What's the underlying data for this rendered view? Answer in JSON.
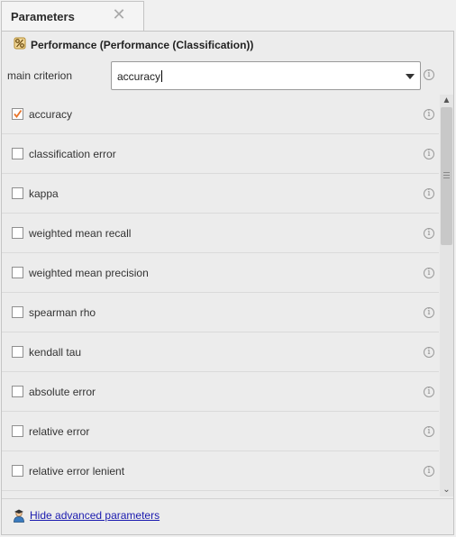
{
  "tab": {
    "label": "Parameters",
    "close_glyph": "✕",
    "close_icon": "close-icon"
  },
  "operator": {
    "icon": "performance-percent-icon",
    "title": "Performance (Performance (Classification))"
  },
  "main_criterion": {
    "label": "main criterion",
    "value": "accuracy",
    "info_glyph": "i"
  },
  "criteria": [
    {
      "label": "accuracy",
      "checked": true
    },
    {
      "label": "classification error",
      "checked": false
    },
    {
      "label": "kappa",
      "checked": false
    },
    {
      "label": "weighted mean recall",
      "checked": false
    },
    {
      "label": "weighted mean precision",
      "checked": false
    },
    {
      "label": "spearman rho",
      "checked": false
    },
    {
      "label": "kendall tau",
      "checked": false
    },
    {
      "label": "absolute error",
      "checked": false
    },
    {
      "label": "relative error",
      "checked": false
    },
    {
      "label": "relative error lenient",
      "checked": false
    }
  ],
  "scrollbar": {
    "up_glyph": "▲",
    "down_glyph": "⌄"
  },
  "footer": {
    "icon": "expert-user-icon",
    "link_label": "Hide advanced parameters"
  },
  "colors": {
    "check_accent": "#e8742a",
    "link": "#1a1aaf",
    "panel_bg": "#ececec",
    "border": "#c4c4c4"
  }
}
